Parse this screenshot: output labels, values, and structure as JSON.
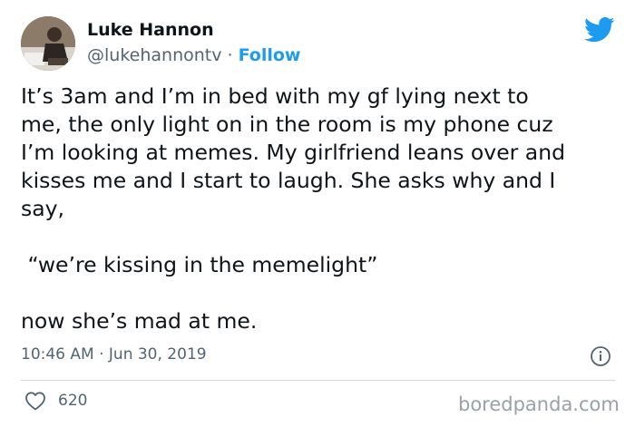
{
  "tweet": {
    "author_name": "Luke Hannon",
    "author_handle": "@lukehannontv",
    "separator": " · ",
    "follow_label": "Follow",
    "body": "It’s 3am and I’m in bed with my gf lying next to\nme, the only light on in the room is my phone cuz\nI’m looking at memes. My girlfriend leans over and\nkisses me and I start to laugh. She asks why and I\nsay,\n\n “we’re kissing in the memelight”\n\nnow she’s mad at me.",
    "timestamp": "10:46 AM · Jun 30, 2019",
    "like_count": "620"
  },
  "icons": {
    "logo": "twitter-bird-icon",
    "info": "info-icon",
    "like": "heart-icon"
  },
  "watermark": "boredpanda.com",
  "colors": {
    "accent": "#1d9bf0",
    "text_primary": "#0f1419",
    "text_secondary": "#536471",
    "divider": "#cfd9de"
  }
}
